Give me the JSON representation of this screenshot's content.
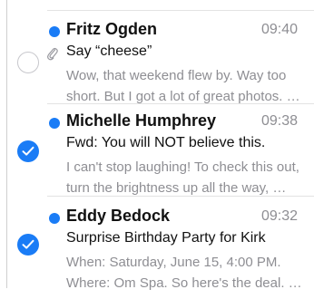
{
  "messages": [
    {
      "sender": "Fritz Ogden",
      "time": "09:40",
      "subject": "Say “cheese”",
      "preview_line1": "Wow, that weekend flew by. Way too",
      "preview_line2": "short. But I got a lot of great photos. …",
      "unread": true,
      "selected": false,
      "has_attachment": true
    },
    {
      "sender": "Michelle Humphrey",
      "time": "09:38",
      "subject": "Fwd: You will NOT believe this.",
      "preview_line1": "I can't stop laughing! To check this out,",
      "preview_line2": "turn the brightness up all the way, …",
      "unread": true,
      "selected": true,
      "has_attachment": false
    },
    {
      "sender": "Eddy Bedock",
      "time": "09:32",
      "subject": "Surprise Birthday Party for Kirk",
      "preview_line1": "When: Saturday, June 15, 4:00 PM.",
      "preview_line2": "Where: Om Spa. So here's the deal. …",
      "unread": true,
      "selected": true,
      "has_attachment": false
    }
  ],
  "colors": {
    "accent": "#1a7cf6",
    "secondary_text": "#8e8e93",
    "primary_text": "#111111"
  },
  "icons": {
    "attachment": "paperclip-icon",
    "selected": "checkmark-icon"
  }
}
